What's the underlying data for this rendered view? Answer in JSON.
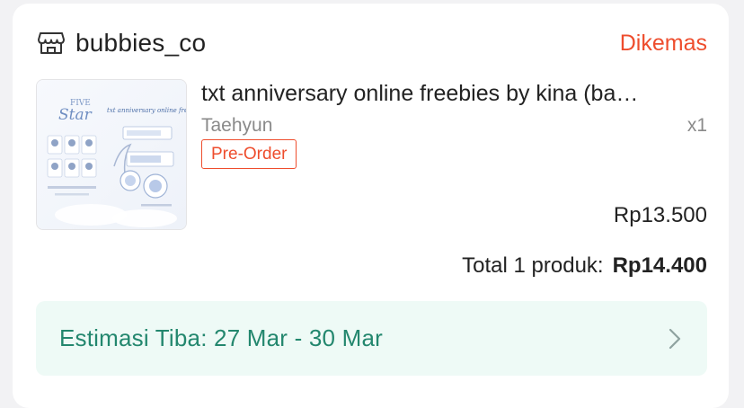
{
  "shop": {
    "icon": "store-icon",
    "name": "bubbies_co",
    "status": "Dikemas",
    "status_color": "#ee4d2d"
  },
  "product": {
    "thumbnail_icon": "product-image",
    "thumbnail_text": {
      "five": "FIVE",
      "star": "Star",
      "heading": "txt anniversary online freebies"
    },
    "title": "txt anniversary online freebies by kina (ba…",
    "variant": "Taehyun",
    "quantity": "x1",
    "badge": "Pre-Order",
    "price": "Rp13.500"
  },
  "summary": {
    "total_label": "Total 1 produk:",
    "total_amount": "Rp14.400"
  },
  "estimate": {
    "text": "Estimasi Tiba: 27 Mar - 30 Mar",
    "icon": "chevron-right-icon",
    "accent_color": "#23876e",
    "background_color": "#eefaf6"
  }
}
